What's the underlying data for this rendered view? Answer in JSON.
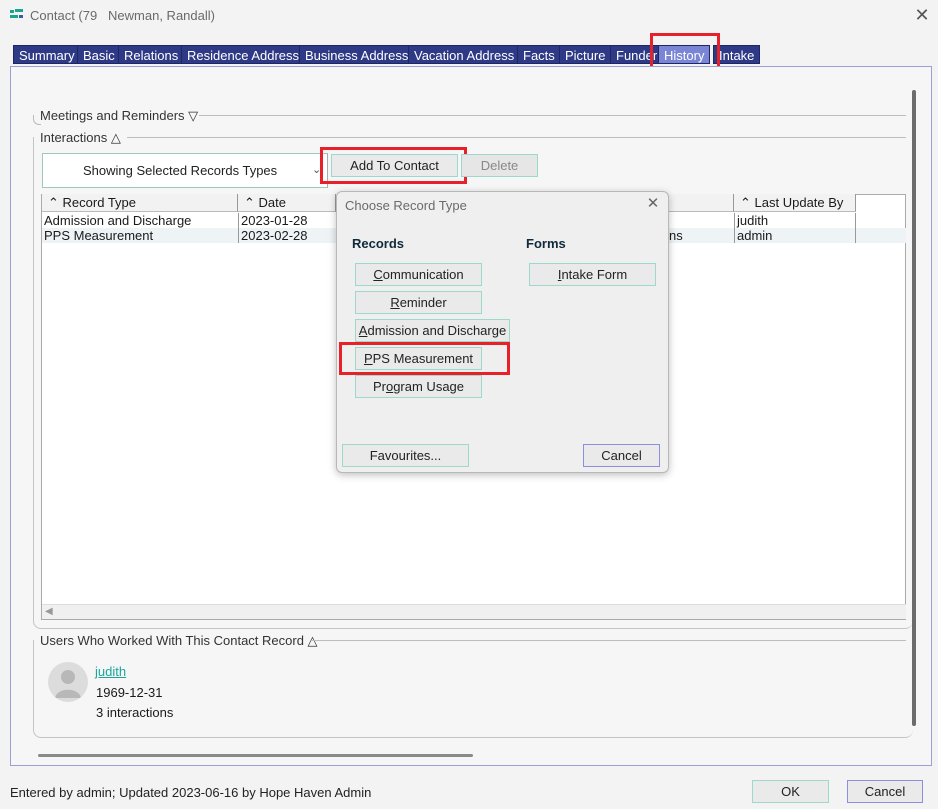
{
  "window": {
    "title": "Contact (79   Newman, Randall)"
  },
  "tabs": [
    {
      "label": "Summary"
    },
    {
      "label": "Basic"
    },
    {
      "label": "Relations"
    },
    {
      "label": "Residence Address"
    },
    {
      "label": "Business Address"
    },
    {
      "label": "Vacation Address"
    },
    {
      "label": "Facts"
    },
    {
      "label": "Picture"
    },
    {
      "label": "Funder"
    },
    {
      "label": "History"
    },
    {
      "label": "Intake"
    }
  ],
  "sections": {
    "meetings": "Meetings and Reminders ▽",
    "interactions": "Interactions △",
    "users": "Users Who Worked With This Contact Record △"
  },
  "interactions": {
    "filter_label": "Showing Selected Records Types",
    "add_button": "Add To Contact",
    "delete_button": "Delete",
    "columns": [
      "Record Type",
      "Date",
      "Last Update By"
    ],
    "rows": [
      {
        "record_type": "Admission and Discharge",
        "date": "2023-01-28",
        "hidden_fragment": "",
        "last_update_by": "judith"
      },
      {
        "record_type": "PPS Measurement",
        "date": "2023-02-28",
        "hidden_fragment": "ns",
        "last_update_by": "admin"
      }
    ]
  },
  "dialog": {
    "title": "Choose Record Type",
    "records_heading": "Records",
    "forms_heading": "Forms",
    "record_buttons": [
      {
        "mnemonic": "C",
        "rest": "ommunication"
      },
      {
        "mnemonic": "R",
        "rest": "eminder"
      },
      {
        "mnemonic": "A",
        "rest": "dmission and Discharge"
      },
      {
        "mnemonic": "P",
        "rest": "PS Measurement"
      },
      {
        "pre": "Pr",
        "mnemonic": "o",
        "rest": "gram Usage"
      }
    ],
    "form_buttons": [
      {
        "mnemonic": "I",
        "rest": "ntake Form"
      }
    ],
    "favourites_button": "Favourites...",
    "cancel_button": "Cancel"
  },
  "users": [
    {
      "name": "judith",
      "date": "1969-12-31",
      "interactions": "3 interactions"
    }
  ],
  "footer": {
    "status": "Entered by admin; Updated 2023-06-16 by Hope Haven Admin",
    "ok_button": "OK",
    "cancel_button": "Cancel"
  },
  "colors": {
    "tab_bg": "#2f3a86",
    "tab_active_bg": "#7a85d6",
    "highlight_red": "#e8202a",
    "link_teal": "#18a89a"
  }
}
